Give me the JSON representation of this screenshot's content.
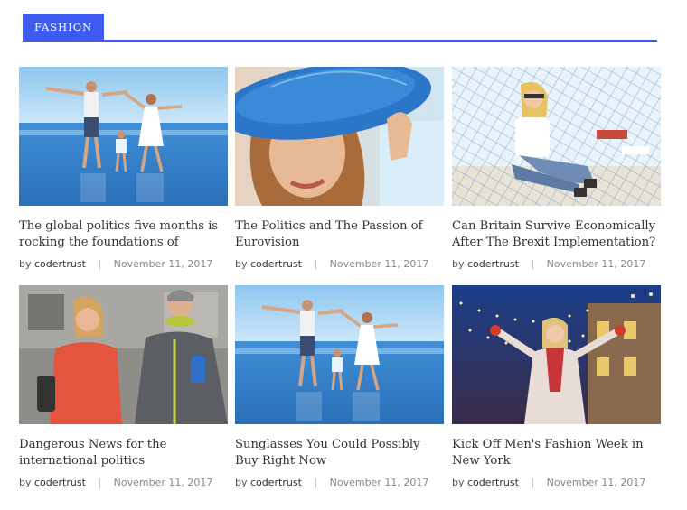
{
  "section": {
    "label": "FASHION",
    "accent": "#3d5af1"
  },
  "articles": [
    {
      "title": "The global politics five months is rocking the foundations of",
      "by": "by",
      "author": "codertrust",
      "sep": "|",
      "date": "November 11, 2017",
      "image": "family-beach-photo"
    },
    {
      "title": "The Politics and The Passion of Eurovision",
      "by": "by",
      "author": "codertrust",
      "sep": "|",
      "date": "November 11, 2017",
      "image": "woman-blue-hat-photo"
    },
    {
      "title": "Can Britain Survive Economically After The Brexit Implementation?",
      "by": "by",
      "author": "codertrust",
      "sep": "|",
      "date": "November 11, 2017",
      "image": "woman-beach-net-photo"
    },
    {
      "title": "Dangerous News for the international politics",
      "by": "by",
      "author": "codertrust",
      "sep": "|",
      "date": "November 11, 2017",
      "image": "couple-sport-photo"
    },
    {
      "title": "Sunglasses You Could Possibly Buy Right Now",
      "by": "by",
      "author": "codertrust",
      "sep": "|",
      "date": "November 11, 2017",
      "image": "family-beach-photo"
    },
    {
      "title": "Kick Off Men's Fashion Week in New York",
      "by": "by",
      "author": "codertrust",
      "sep": "|",
      "date": "November 11, 2017",
      "image": "woman-winter-lights-photo"
    }
  ]
}
